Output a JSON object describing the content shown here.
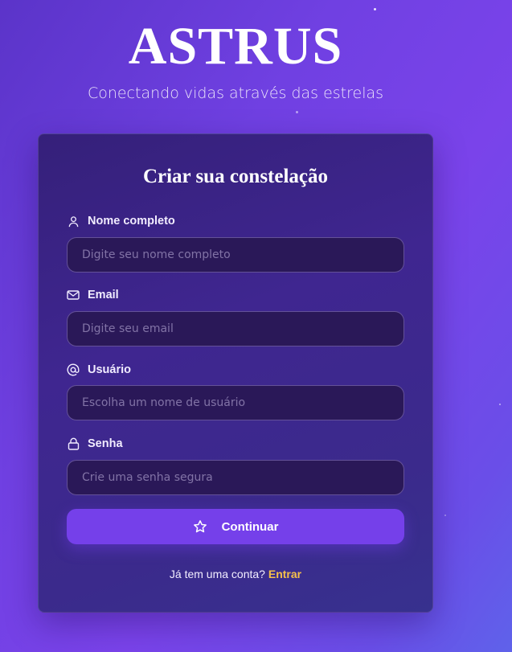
{
  "brand": {
    "title": "ASTRUS",
    "tagline": "Conectando vidas através das estrelas"
  },
  "form": {
    "title": "Criar sua constelação",
    "fields": [
      {
        "label": "Nome completo",
        "icon": "user-icon",
        "placeholder": "Digite seu nome completo",
        "value": ""
      },
      {
        "label": "Email",
        "icon": "mail-icon",
        "placeholder": "Digite seu email",
        "value": ""
      },
      {
        "label": "Usuário",
        "icon": "at-icon",
        "placeholder": "Escolha um nome de usuário",
        "value": ""
      },
      {
        "label": "Senha",
        "icon": "lock-icon",
        "placeholder": "Crie uma senha segura",
        "value": ""
      }
    ],
    "submit": {
      "label": "Continuar",
      "icon": "star-icon"
    },
    "signin": {
      "prompt": "Já tem uma conta?",
      "link": "Entrar"
    }
  },
  "colors": {
    "accent": "#7540ea",
    "link": "#f6c04a"
  }
}
